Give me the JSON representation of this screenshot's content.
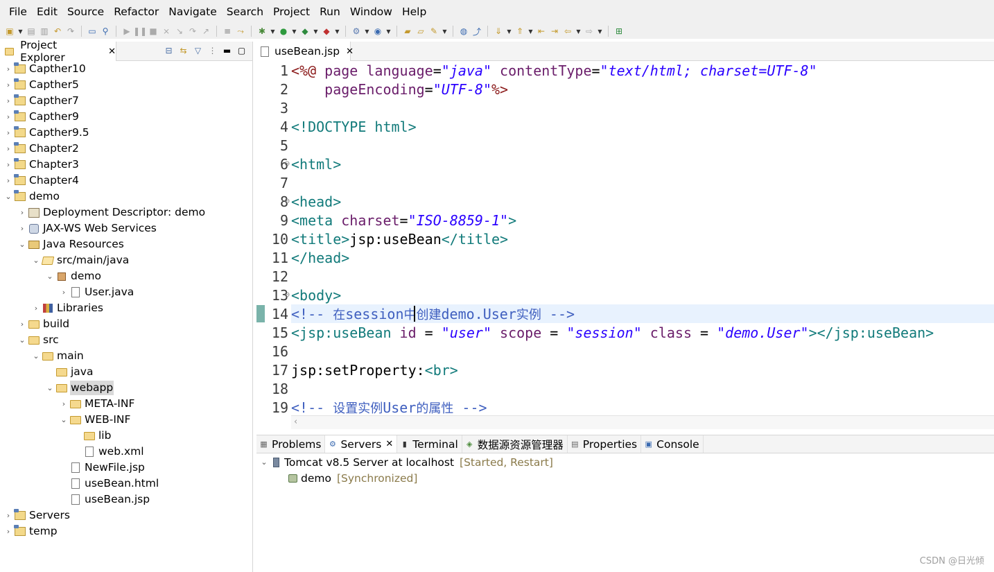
{
  "menu": [
    "File",
    "Edit",
    "Source",
    "Refactor",
    "Navigate",
    "Search",
    "Project",
    "Run",
    "Window",
    "Help"
  ],
  "explorer": {
    "tab_label": "Project Explorer",
    "items": [
      {
        "label": "Capther10",
        "icon": "project-icon",
        "chev": "›"
      },
      {
        "label": "Capther5",
        "icon": "project-icon",
        "chev": "›"
      },
      {
        "label": "Capther7",
        "icon": "project-icon",
        "chev": "›"
      },
      {
        "label": "Capther9",
        "icon": "project-icon",
        "chev": "›"
      },
      {
        "label": "Capther9.5",
        "icon": "project-icon",
        "chev": "›"
      },
      {
        "label": "Chapter2",
        "icon": "project-icon",
        "chev": "›"
      },
      {
        "label": "Chapter3",
        "icon": "project-icon",
        "chev": "›"
      },
      {
        "label": "Chapter4",
        "icon": "project-icon",
        "chev": "›"
      },
      {
        "label": "demo",
        "icon": "project-icon",
        "chev": "⌄"
      },
      {
        "label": "Deployment Descriptor: demo",
        "icon": "deployment-descriptor-icon",
        "chev": "›"
      },
      {
        "label": "JAX-WS Web Services",
        "icon": "web-services-icon",
        "chev": "›"
      },
      {
        "label": "Java Resources",
        "icon": "java-resources-icon",
        "chev": "⌄"
      },
      {
        "label": "src/main/java",
        "icon": "source-folder-icon",
        "chev": "⌄"
      },
      {
        "label": "demo",
        "icon": "package-icon",
        "chev": "⌄"
      },
      {
        "label": "User.java",
        "icon": "java-file-icon",
        "chev": "›"
      },
      {
        "label": "Libraries",
        "icon": "libraries-icon",
        "chev": "›"
      },
      {
        "label": "build",
        "icon": "folder-icon",
        "chev": "›"
      },
      {
        "label": "src",
        "icon": "folder-icon",
        "chev": "⌄"
      },
      {
        "label": "main",
        "icon": "folder-icon",
        "chev": "⌄"
      },
      {
        "label": "java",
        "icon": "folder-icon",
        "chev": ""
      },
      {
        "label": "webapp",
        "icon": "folder-icon",
        "chev": "⌄"
      },
      {
        "label": "META-INF",
        "icon": "folder-icon",
        "chev": "›"
      },
      {
        "label": "WEB-INF",
        "icon": "folder-icon",
        "chev": "⌄"
      },
      {
        "label": "lib",
        "icon": "folder-icon",
        "chev": ""
      },
      {
        "label": "web.xml",
        "icon": "xml-file-icon",
        "chev": ""
      },
      {
        "label": "NewFile.jsp",
        "icon": "jsp-file-icon",
        "chev": ""
      },
      {
        "label": "useBean.html",
        "icon": "html-file-icon",
        "chev": ""
      },
      {
        "label": "useBean.jsp",
        "icon": "jsp-file-icon",
        "chev": ""
      },
      {
        "label": "Servers",
        "icon": "project-icon",
        "chev": "›"
      },
      {
        "label": "temp",
        "icon": "project-icon",
        "chev": "›"
      }
    ]
  },
  "editor": {
    "tab_label": "useBean.jsp",
    "line_numbers": [
      "1",
      "2",
      "3",
      "4",
      "5",
      "6",
      "7",
      "8",
      "9",
      "10",
      "11",
      "12",
      "13",
      "14",
      "15",
      "16",
      "17",
      "18",
      "19"
    ],
    "lines": {
      "l1": {
        "a": "<%@",
        "b": " page ",
        "c": "language",
        "d": "=",
        "e": "\"java\"",
        "f": " contentType",
        "g": "=",
        "h": "\"text/html; charset=UTF-8\""
      },
      "l2": {
        "a": "    pageEncoding",
        "b": "=",
        "c": "\"UTF-8\"",
        "d": "%>"
      },
      "l4": "<!DOCTYPE html>",
      "l6": "<html>",
      "l8": "<head>",
      "l9": {
        "a": "<meta",
        "b": " charset",
        "c": "=",
        "d": "\"ISO-8859-1\"",
        "e": ">"
      },
      "l10": {
        "a": "<title>",
        "b": "jsp:useBean",
        "c": "</title>"
      },
      "l11": "</head>",
      "l13": "<body>",
      "l14": {
        "a": "<!-- ",
        "b": "在",
        "c": "session",
        "d": "中创建",
        "e": "demo.User",
        "f": "实例",
        "g": " -->"
      },
      "l15": {
        "a": "<jsp:useBean",
        "b": " id",
        "c": " = ",
        "d": "\"user\"",
        "e": " scope",
        "f": " = ",
        "g": "\"session\"",
        "h": " class",
        "i": " = ",
        "j": "\"demo.User\"",
        "k": "></jsp:useBean>"
      },
      "l17": {
        "a": "jsp:setProperty:",
        "b": "<br>"
      },
      "l19": {
        "a": "<!-- ",
        "b": "设置实例",
        "c": "User",
        "d": "的属性",
        "e": " -->"
      }
    }
  },
  "bottom_panel": {
    "tabs": [
      "Problems",
      "Servers",
      "Terminal",
      "数据源资源管理器",
      "Properties",
      "Console"
    ],
    "server": {
      "name": "Tomcat v8.5 Server at localhost",
      "state": "[Started, Restart]"
    },
    "module": {
      "name": "demo",
      "state": "[Synchronized]"
    }
  },
  "watermark": "CSDN @日光倾"
}
